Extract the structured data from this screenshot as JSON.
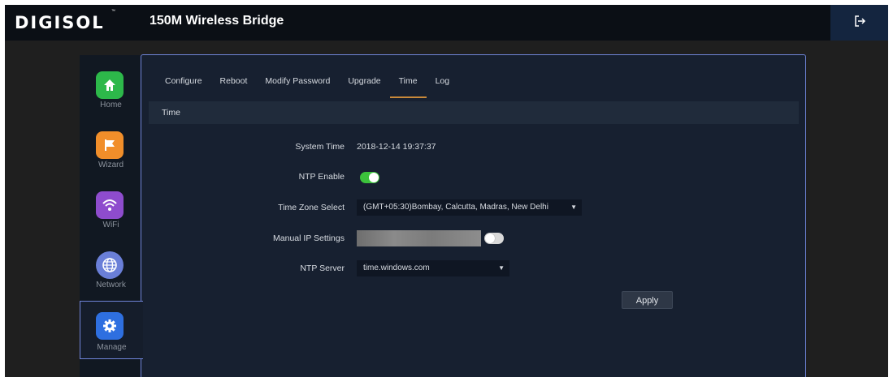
{
  "header": {
    "logo": "DIGISOL",
    "logo_tm": "™",
    "title": "150M Wireless Bridge",
    "logout_icon": "logout-icon"
  },
  "sidebar": {
    "items": [
      {
        "label": "Home",
        "icon": "home-icon",
        "color": "#2db84a"
      },
      {
        "label": "Wizard",
        "icon": "flag-icon",
        "color": "#f18e2a"
      },
      {
        "label": "WiFi",
        "icon": "wifi-icon",
        "color": "#8e4ccd"
      },
      {
        "label": "Network",
        "icon": "globe-icon",
        "color": "#6a7fd8"
      },
      {
        "label": "Manage",
        "icon": "gear-icon",
        "color": "#2e6fe0"
      }
    ],
    "active": "Manage"
  },
  "tabs": [
    "Configure",
    "Reboot",
    "Modify Password",
    "Upgrade",
    "Time",
    "Log"
  ],
  "active_tab": "Time",
  "section_title": "Time",
  "form": {
    "system_time_label": "System Time",
    "system_time_value": "2018-12-14 19:37:37",
    "ntp_enable_label": "NTP Enable",
    "ntp_enable_on": true,
    "timezone_label": "Time Zone Select",
    "timezone_value": "(GMT+05:30)Bombay, Calcutta, Madras, New Delhi",
    "manual_ip_label": "Manual IP Settings",
    "manual_ip_value": "",
    "manual_ip_on": false,
    "ntp_server_label": "NTP Server",
    "ntp_server_value": "time.windows.com",
    "caret": "▼",
    "apply_label": "Apply"
  },
  "colors": {
    "accent_tab": "#c9893a",
    "toggle_on": "#3cc23c",
    "panel_border": "#6f84d8"
  }
}
